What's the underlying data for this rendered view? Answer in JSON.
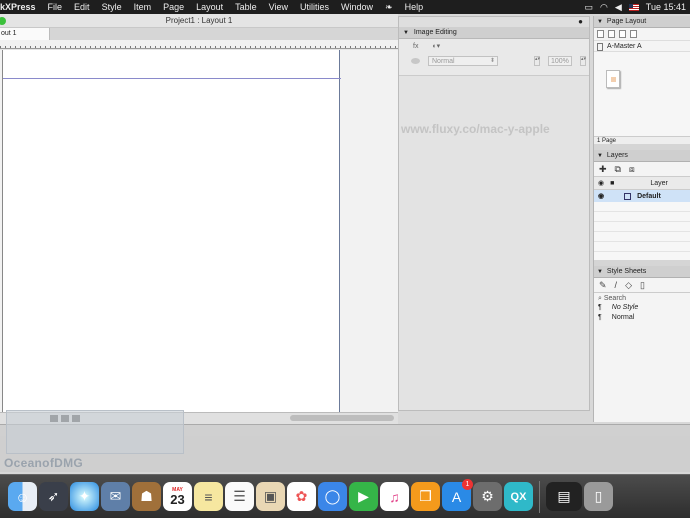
{
  "menubar": {
    "app": "kXPress",
    "items": [
      "File",
      "Edit",
      "Style",
      "Item",
      "Page",
      "Layout",
      "Table",
      "View",
      "Utilities",
      "Window",
      "Help"
    ],
    "clock": "Tue 15:41"
  },
  "document": {
    "title": "Project1 : Layout 1",
    "tab": "out 1"
  },
  "image_editing": {
    "title": "Image Editing",
    "fx_label": "fx",
    "blend_mode": "Normal",
    "opacity": "100%",
    "watermark": "www.fluxy.co/mac-y-apple"
  },
  "page_layout": {
    "title": "Page Layout",
    "master": "A-Master A",
    "page_count": "1 Page"
  },
  "layers": {
    "title": "Layers",
    "column": "Layer",
    "default_layer": "Default"
  },
  "style_sheets": {
    "title": "Style Sheets",
    "search": "Search",
    "items": [
      "No Style",
      "Normal"
    ],
    "pilcrow": "¶"
  },
  "watermark_bottom": "OceanofDMG",
  "dock": {
    "calendar_month": "MAY",
    "calendar_day": "23",
    "appstore_badge": "1",
    "quark_label": "QX"
  },
  "colors": {
    "menubar": "#1e1e1e",
    "selection": "#cfe2f7",
    "accent_green": "#3cc13c"
  }
}
